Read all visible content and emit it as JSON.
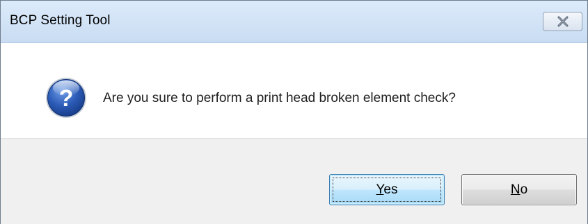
{
  "window": {
    "title": "BCP Setting Tool",
    "close_icon": "close-x-icon"
  },
  "message": {
    "icon": "question-icon",
    "text": "Are you sure to perform a print head broken element check?"
  },
  "buttons": {
    "yes": {
      "mnemonic": "Y",
      "rest": "es",
      "focused": true
    },
    "no": {
      "mnemonic": "N",
      "rest": "o",
      "focused": false
    }
  },
  "colors": {
    "titlebar": "#c9dcf2",
    "footer": "#f0f0f0",
    "icon_blue": "#1f4fa3",
    "default_button_border": "#3c7fb1"
  }
}
